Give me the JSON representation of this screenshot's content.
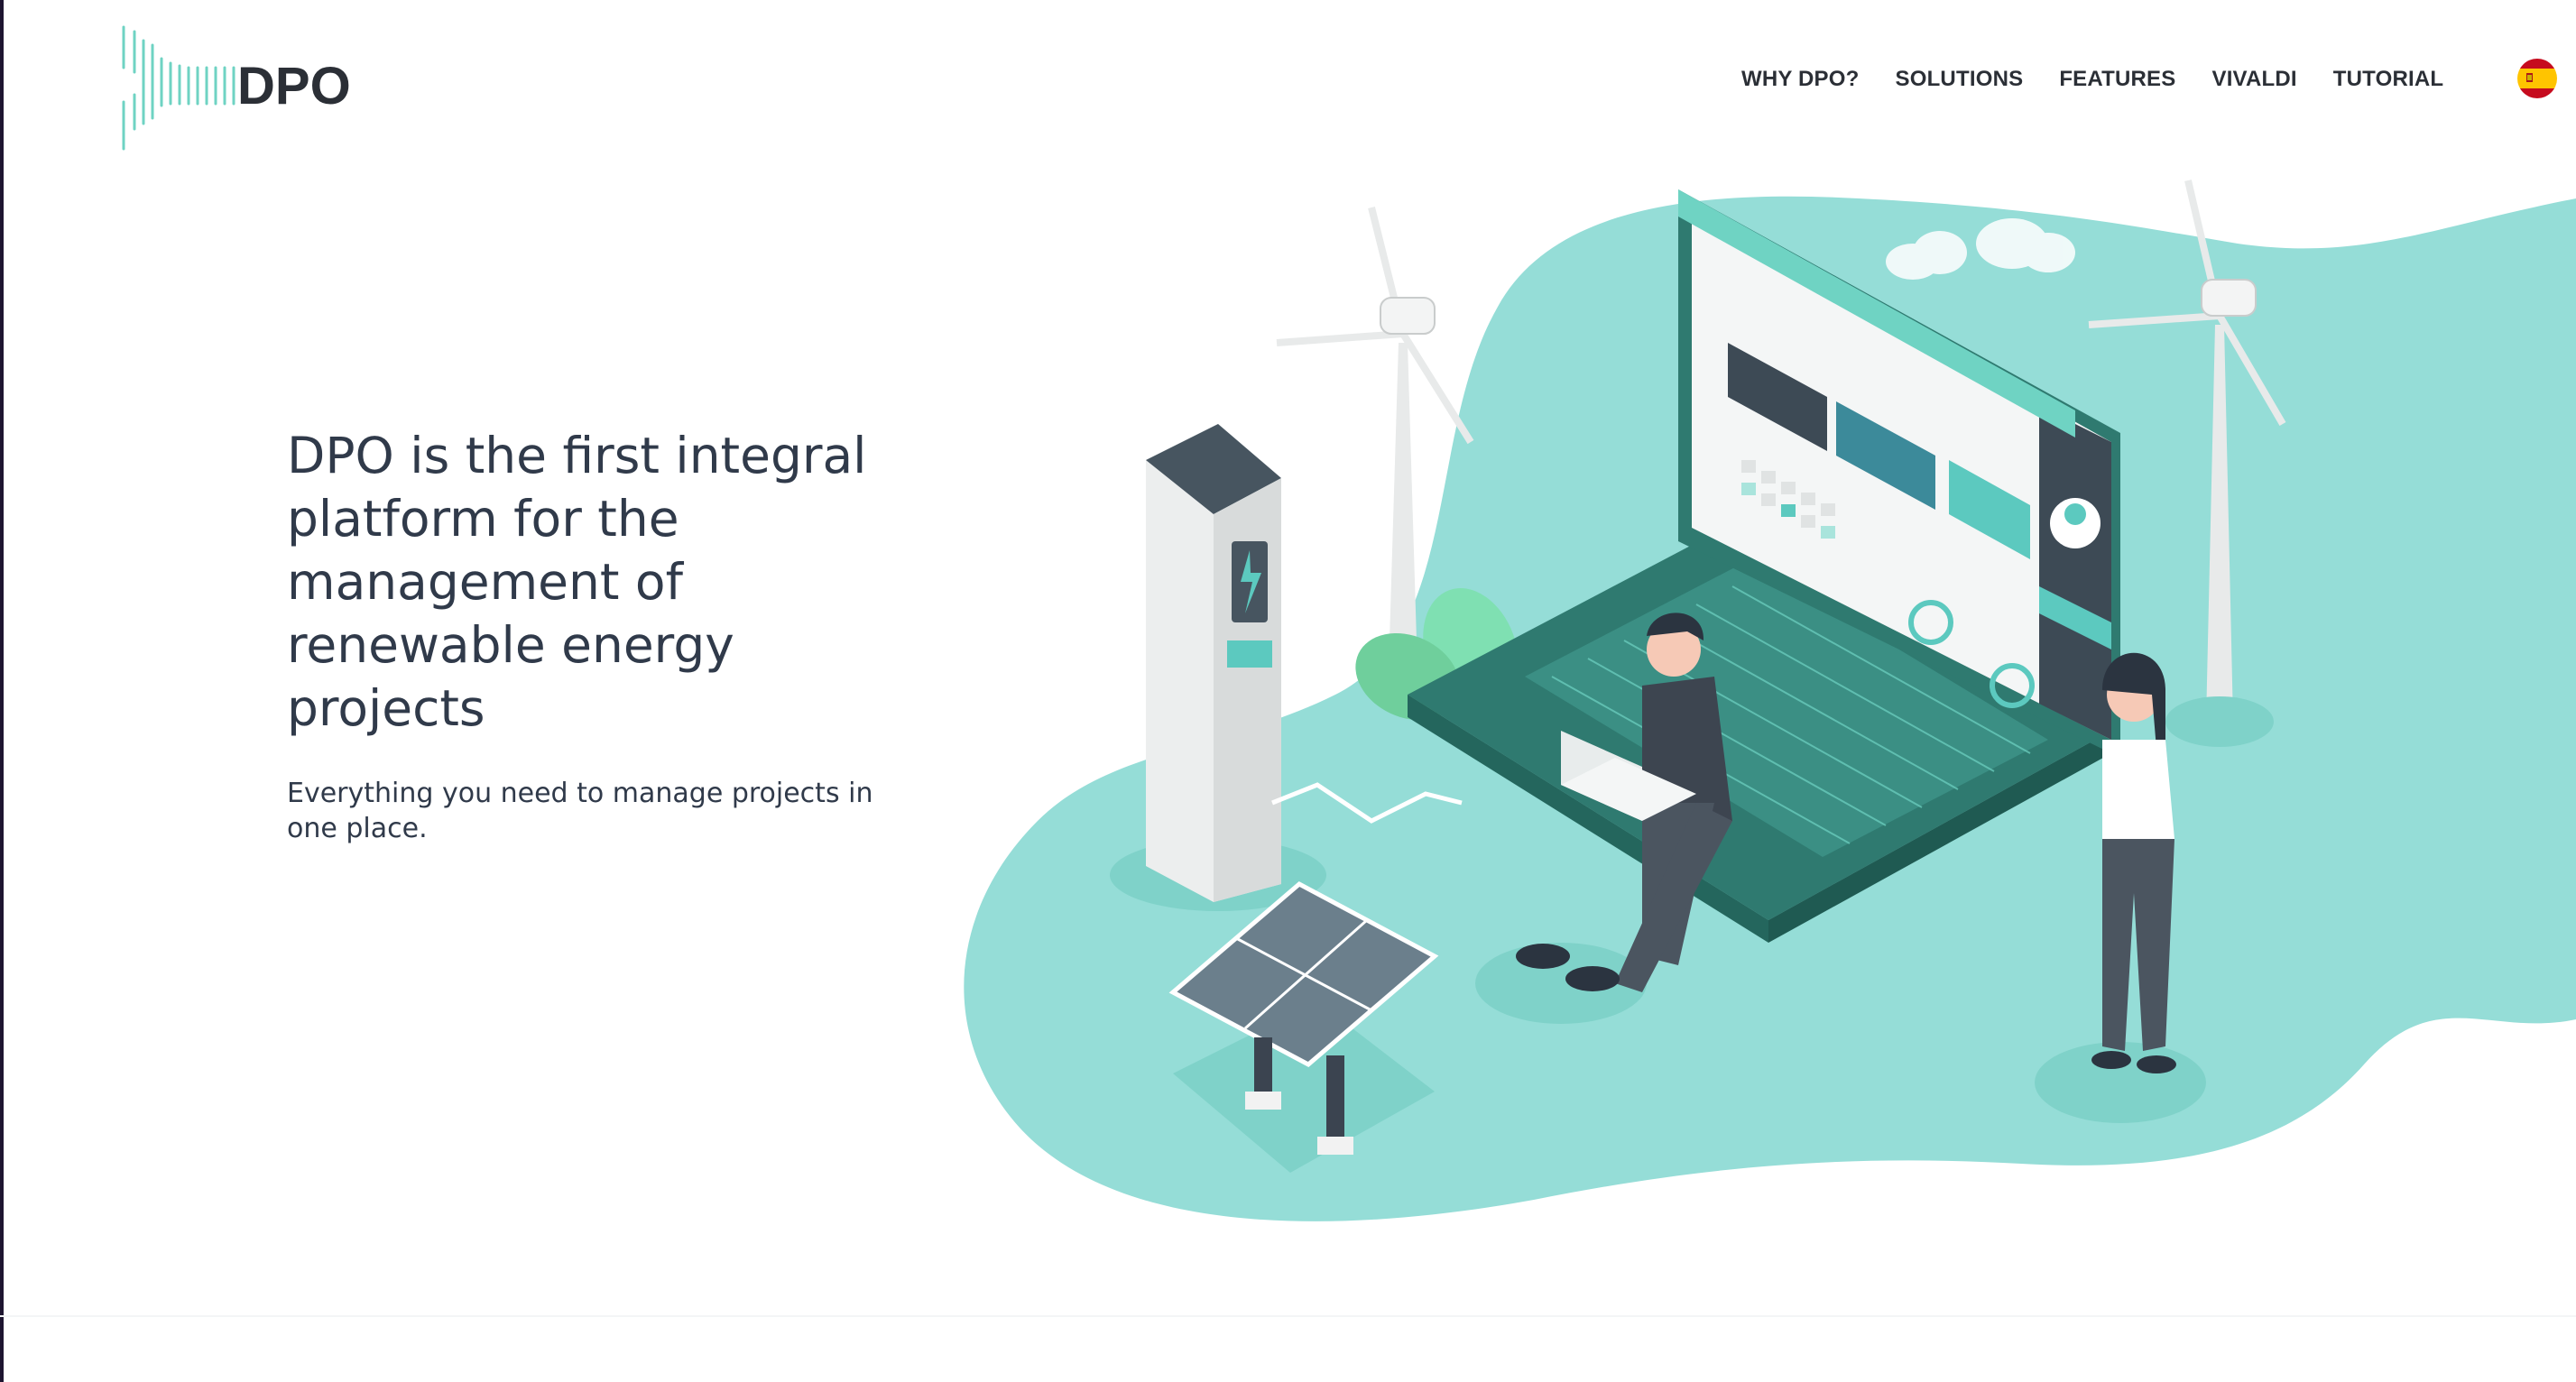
{
  "header": {
    "logo_text": "DPO",
    "nav": [
      {
        "label": "WHY DPO?"
      },
      {
        "label": "SOLUTIONS"
      },
      {
        "label": "FEATURES"
      },
      {
        "label": "VIVALDI"
      },
      {
        "label": "TUTORIAL"
      }
    ],
    "language_flag_icon": "spain-flag-icon"
  },
  "hero": {
    "title": "DPO is the first integral platform for the management of renewable energy projects",
    "subtitle": "Everything you need to manage projects in one place."
  },
  "colors": {
    "accent": "#5cc9bf",
    "blob": "#95ddd7",
    "dark_teal": "#2f7a70",
    "text": "#303a4a"
  }
}
